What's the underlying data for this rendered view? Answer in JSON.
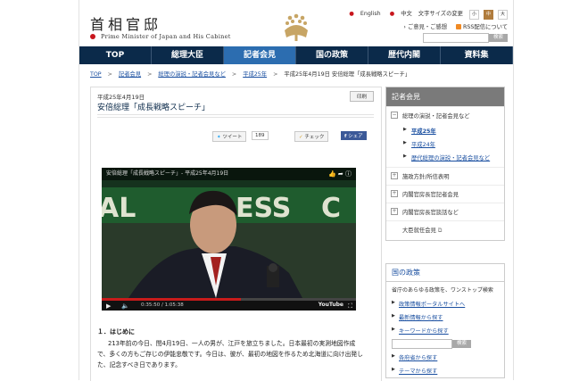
{
  "header": {
    "site_title": "首相官邸",
    "site_subtitle": "Prime Minister of Japan and His Cabinet",
    "util": {
      "english": "English",
      "chinese": "中文",
      "font_size_label": "文字サイズの変更",
      "small": "小",
      "medium": "中",
      "large": "大",
      "opinion": "ご意見・ご感想",
      "rss": "RSS配信について",
      "search_button": "検索"
    }
  },
  "nav": {
    "items": [
      "TOP",
      "総理大臣",
      "記者会見",
      "国の政策",
      "歴代内閣",
      "資料集"
    ],
    "active_index": 2
  },
  "breadcrumb": [
    "TOP",
    "記者会見",
    "総理の演説・記者会見など",
    "平成25年",
    "平成25年4月19日 安倍総理「成長戦略スピーチ」"
  ],
  "article": {
    "date": "平成25年4月19日",
    "title": "安倍総理「成長戦略スピーチ」",
    "print_label": "印刷",
    "share": {
      "tweet": "ツイート",
      "tweet_count": "189",
      "check": "チェック",
      "facebook": "シェア"
    },
    "video": {
      "title": "安倍総理「成長戦略スピーチ」- 平成25年4月19日",
      "time_current": "0:35:50",
      "time_total": "1:05:38",
      "progress": 0.546,
      "youtube": "YouTube"
    },
    "section_heading": "１．はじめに",
    "body": "213年前の今日、閏4月19日、一人の男が、江戸を旅立ちました。日本最初の実測地図作成で、多くの方もご存じの伊能忠敬です。今日は、彼が、最初の地図を作るため北海道に向け出発した、記念すべき日であります。"
  },
  "sidebar": {
    "section_title": "記者会見",
    "items": [
      {
        "label": "総理の演説・記者会見など",
        "expanded": true,
        "children": [
          {
            "label": "平成25年",
            "current": true
          },
          {
            "label": "平成24年",
            "current": false
          },
          {
            "label": "歴代総理の演説・記者会見など",
            "current": false
          }
        ]
      },
      {
        "label": "施政方針/所信表明",
        "expanded": false
      },
      {
        "label": "内閣官房長官記者会見",
        "expanded": false
      },
      {
        "label": "内閣官房長官談話など",
        "expanded": false
      },
      {
        "label": "大臣就任会見",
        "expanded": false
      }
    ],
    "policy": {
      "title": "国の政策",
      "description": "省庁のあらゆる政策を、ワンストップ検索",
      "links": [
        "政策情報ポータルサイトへ",
        "最新情報から探す",
        "キーワードから探す"
      ],
      "search_button": "検索",
      "links2": [
        "各府省から探す",
        "テーマから探す"
      ]
    }
  },
  "colors": {
    "nav_bg": "#0b2a4a",
    "nav_active": "#2c6db0",
    "accent_red": "#c8161d",
    "link": "#1a4fa0"
  }
}
